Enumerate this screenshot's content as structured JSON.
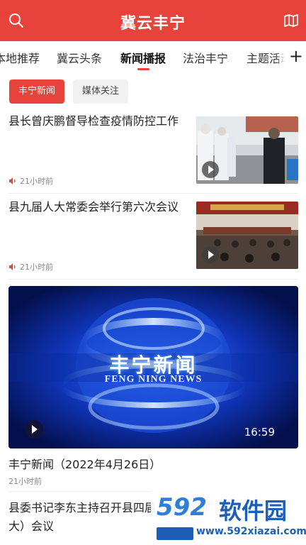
{
  "app": {
    "title": "冀云丰宁"
  },
  "tabs": [
    {
      "label": "本地推荐"
    },
    {
      "label": "冀云头条"
    },
    {
      "label": "新闻播报"
    },
    {
      "label": "法治丰宁"
    },
    {
      "label": "主题活动"
    }
  ],
  "add_tab_label": "+",
  "subtabs": [
    {
      "label": "丰宁新闻"
    },
    {
      "label": "媒体关注"
    }
  ],
  "articles": [
    {
      "title": "县长曾庆鹏督导检查疫情防控工作",
      "time": "21小时前"
    },
    {
      "title": "县九届人大常委会举行第六次会议",
      "time": "21小时前"
    }
  ],
  "video": {
    "brand": "丰宁新闻",
    "brand_en": "FENG NING NEWS",
    "duration": "16:59",
    "title": "丰宁新闻（2022年4月26日）",
    "time": "21小时前"
  },
  "last_article": {
    "title": "县委书记李东主持召开县四届…联席（扩大）会议"
  },
  "watermark": {
    "num": "592",
    "name": "软件园",
    "url": "www.592xiazai.com"
  },
  "colors": {
    "brand_red": "#e8433b",
    "video_blue": "#0a2a9a"
  }
}
